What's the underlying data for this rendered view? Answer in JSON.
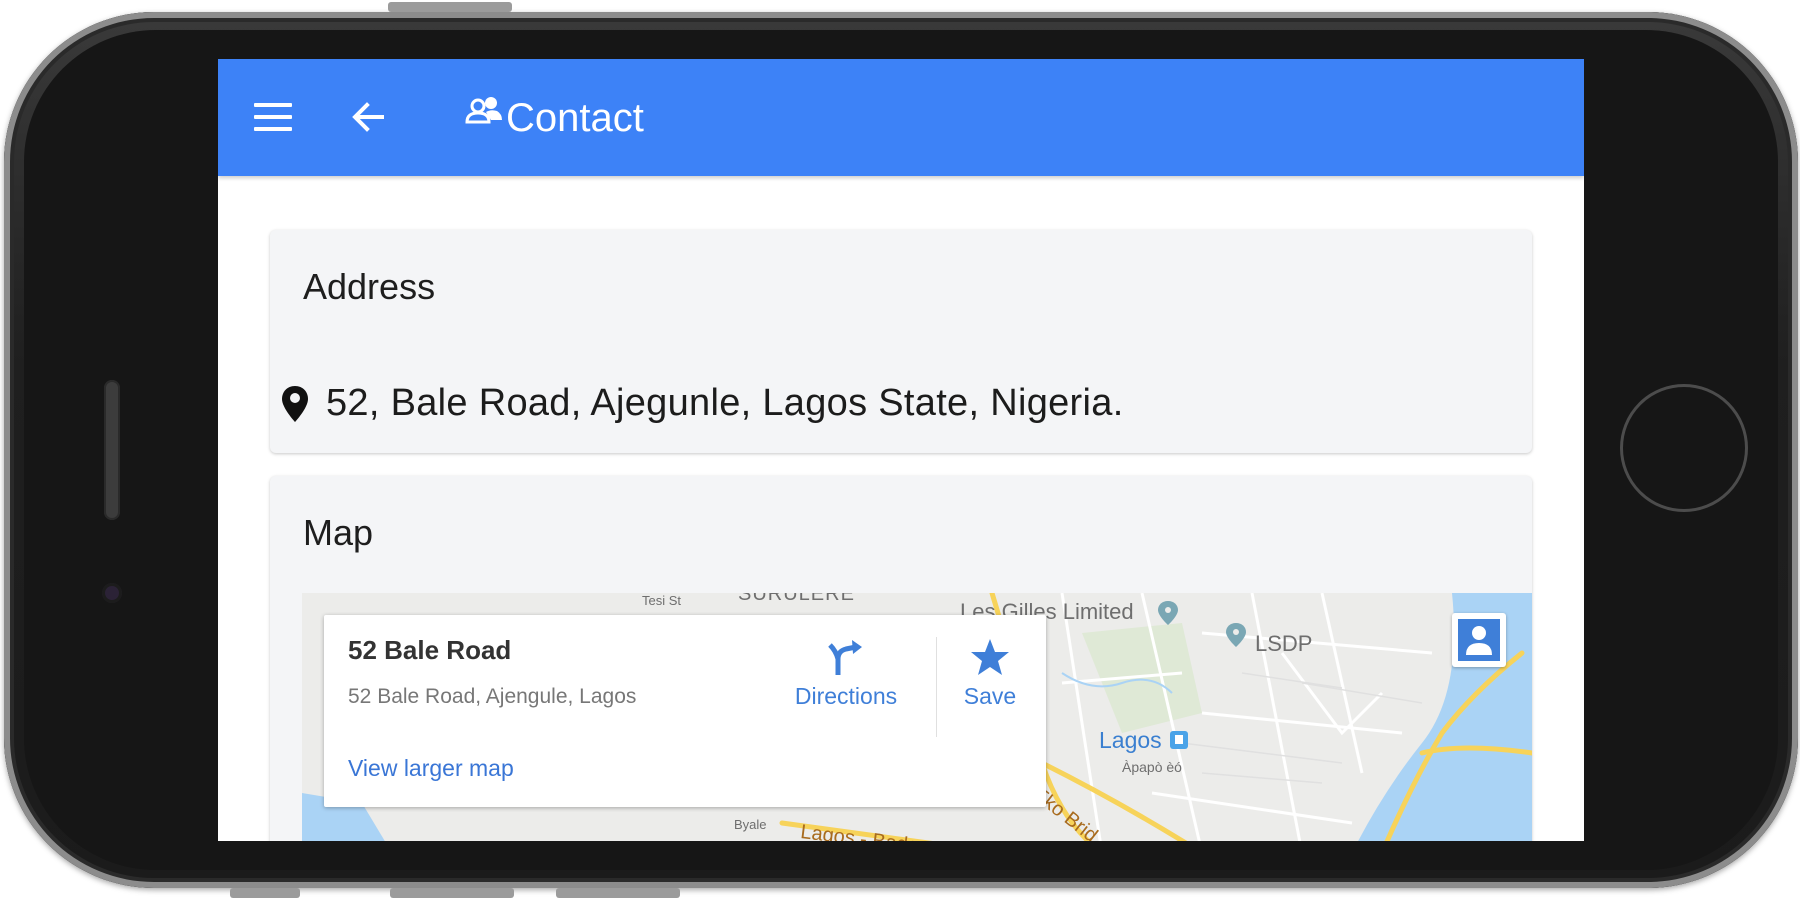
{
  "app_bar": {
    "title": "Contact",
    "title_icon": "users-icon",
    "menu_icon": "hamburger-menu-icon",
    "back_icon": "arrow-back-icon",
    "color": "#3d82f7"
  },
  "address_card": {
    "title": "Address",
    "icon": "map-pin-icon",
    "address": "52, Bale Road, Ajegunle, Lagos State, Nigeria."
  },
  "map_card": {
    "title": "Map",
    "info": {
      "place_name": "52 Bale Road",
      "place_address": "52 Bale Road, Ajengule, Lagos",
      "view_larger": "View larger map",
      "directions_label": "Directions",
      "save_label": "Save",
      "directions_icon": "directions-icon",
      "save_icon": "star-icon"
    },
    "labels": {
      "les_gilles": "Les Gilles Limited",
      "lsdp": "LSDP",
      "lagos": "Lagos",
      "lagos_local": "Àpapò èó",
      "eko_bridge": "Eko Brid",
      "badagry": "Lagos - Badagry Exp",
      "byale": "Byale",
      "top_street": "Tesi St",
      "top_area": "SURULERE"
    },
    "pegman_icon": "street-view-pegman-icon",
    "colors": {
      "land": "#ececea",
      "water": "#aad3f5",
      "highway": "#f7d35a",
      "road": "#ffffff",
      "park": "#d7ecd0"
    }
  }
}
